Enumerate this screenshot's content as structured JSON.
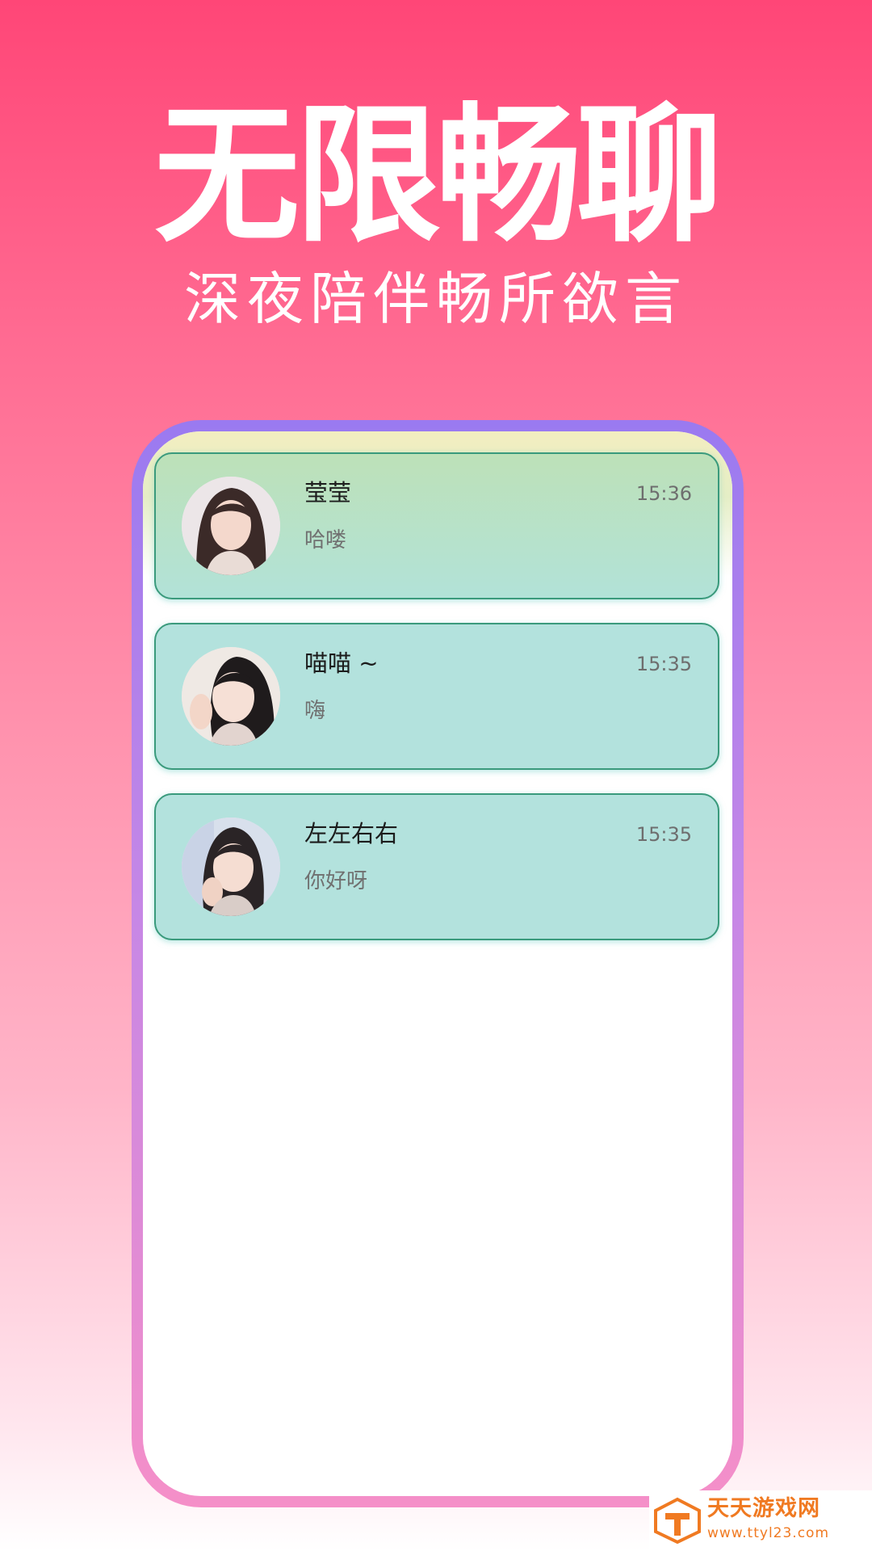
{
  "promo": {
    "headline": "无限畅聊",
    "subheadline": "深夜陪伴畅所欲言"
  },
  "chats": [
    {
      "name": "莹莹",
      "time": "15:36",
      "preview": "哈喽"
    },
    {
      "name": "喵喵 ~",
      "time": "15:35",
      "preview": "嗨"
    },
    {
      "name": "左左右右",
      "time": "15:35",
      "preview": "你好呀"
    }
  ],
  "watermark": {
    "name": "天天游戏网",
    "url": "www.ttyl23.com"
  },
  "colors": {
    "background_top": "#ff4677",
    "background_bottom": "#ffffff",
    "phone_frame_top": "#9a7af0",
    "phone_frame_bottom": "#f58fc8",
    "card_fill": "#b3e2dd",
    "card_border": "#3a9a7c",
    "watermark": "#f07a22"
  },
  "icons": {
    "avatar": "person-avatar-icon",
    "watermark_logo": "cube-logo-icon"
  }
}
